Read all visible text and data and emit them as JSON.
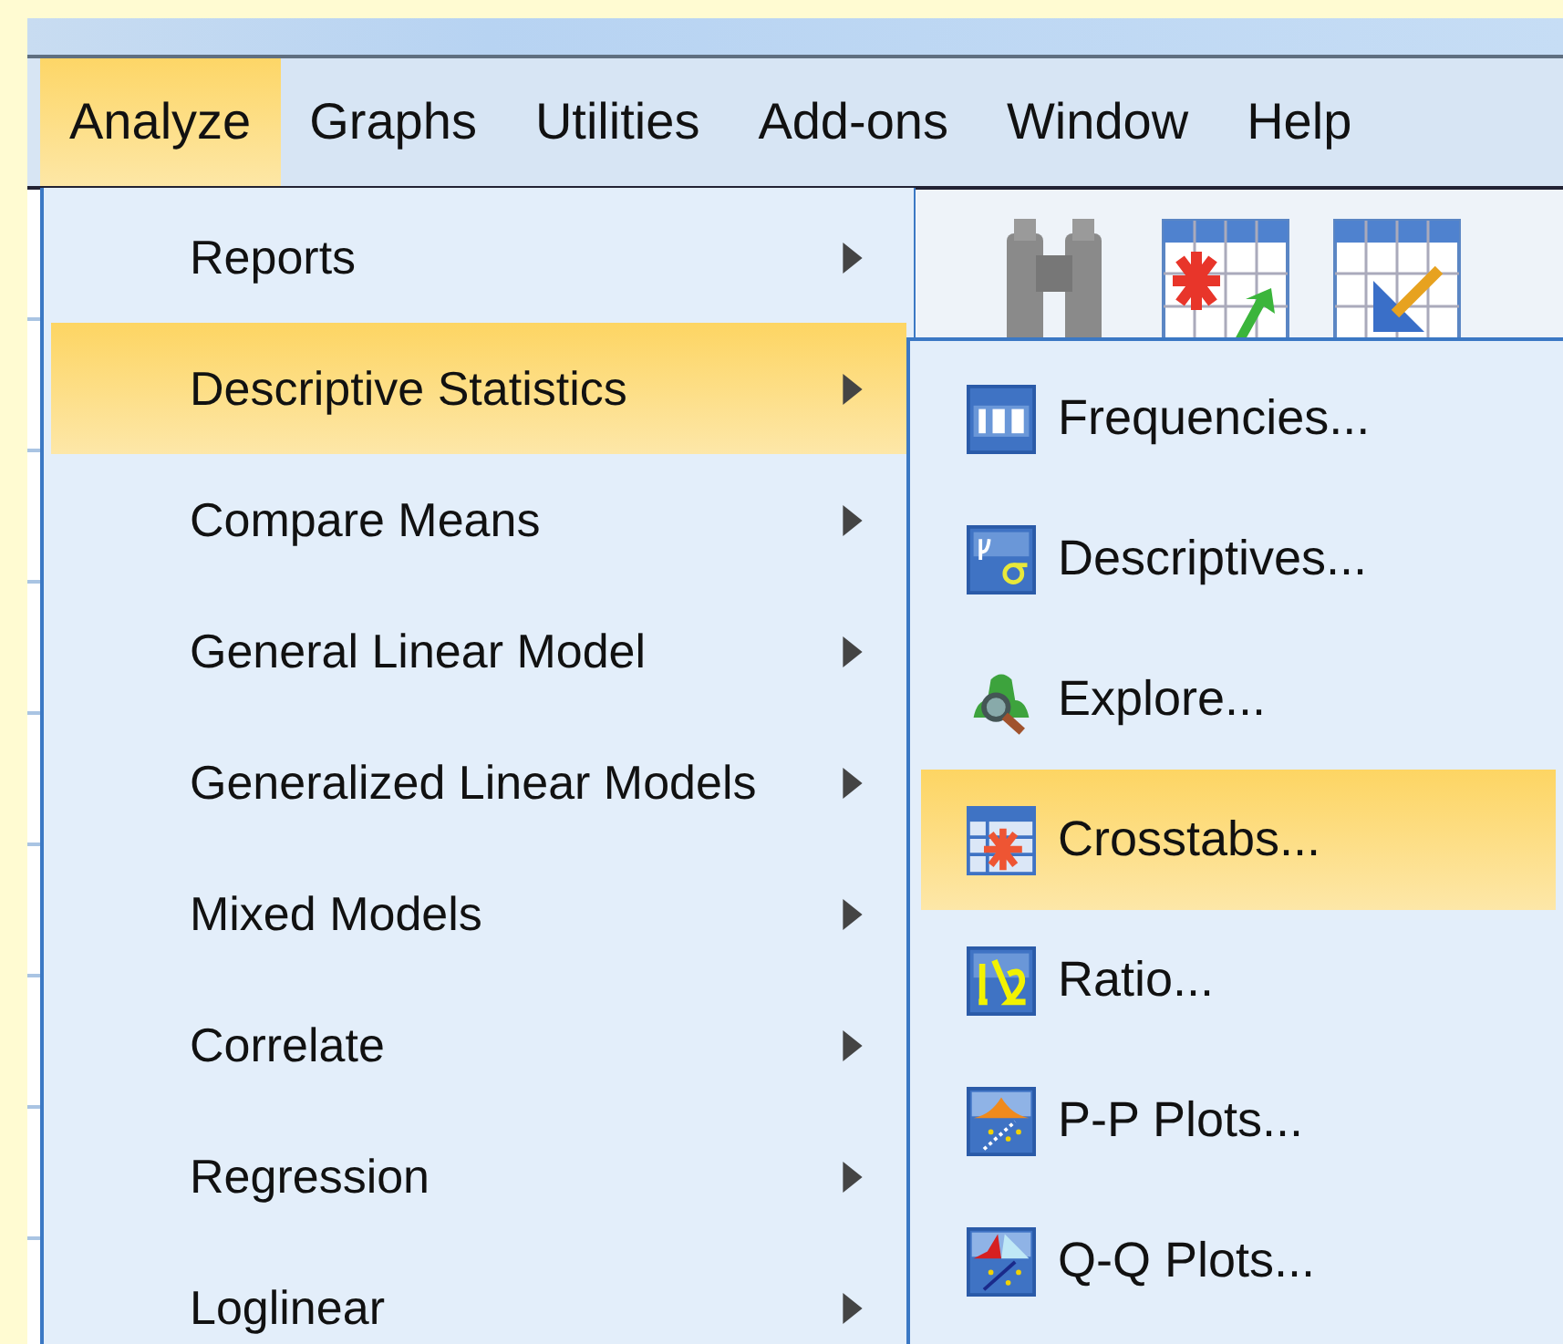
{
  "menu_bar": {
    "items": [
      {
        "label": "Analyze",
        "selected": true
      },
      {
        "label": "Graphs",
        "selected": false
      },
      {
        "label": "Utilities",
        "selected": false
      },
      {
        "label": "Add-ons",
        "selected": false
      },
      {
        "label": "Window",
        "selected": false
      },
      {
        "label": "Help",
        "selected": false
      }
    ]
  },
  "menu": {
    "items": [
      {
        "label": "Reports",
        "selected": false,
        "has_submenu": true
      },
      {
        "label": "Descriptive Statistics",
        "selected": true,
        "has_submenu": true
      },
      {
        "label": "Compare Means",
        "selected": false,
        "has_submenu": true
      },
      {
        "label": "General Linear Model",
        "selected": false,
        "has_submenu": true
      },
      {
        "label": "Generalized Linear Models",
        "selected": false,
        "has_submenu": true
      },
      {
        "label": "Mixed Models",
        "selected": false,
        "has_submenu": true
      },
      {
        "label": "Correlate",
        "selected": false,
        "has_submenu": true
      },
      {
        "label": "Regression",
        "selected": false,
        "has_submenu": true
      },
      {
        "label": "Loglinear",
        "selected": false,
        "has_submenu": true
      }
    ]
  },
  "submenu": {
    "items": [
      {
        "label": "Frequencies...",
        "selected": false,
        "kind": "frequencies"
      },
      {
        "label": "Descriptives...",
        "selected": false,
        "kind": "descriptives"
      },
      {
        "label": "Explore...",
        "selected": false,
        "kind": "explore"
      },
      {
        "label": "Crosstabs...",
        "selected": true,
        "kind": "crosstabs"
      },
      {
        "label": "Ratio...",
        "selected": false,
        "kind": "ratio"
      },
      {
        "label": "P-P Plots...",
        "selected": false,
        "kind": "ppplot"
      },
      {
        "label": "Q-Q Plots...",
        "selected": false,
        "kind": "qqplot"
      }
    ]
  }
}
